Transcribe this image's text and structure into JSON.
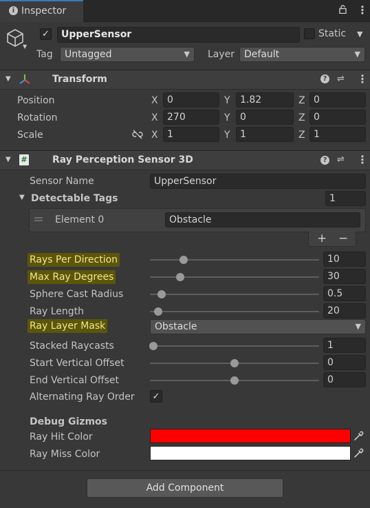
{
  "tab": {
    "title": "Inspector"
  },
  "object": {
    "name": "UpperSensor",
    "static_label": "Static",
    "tag_label": "Tag",
    "tag_value": "Untagged",
    "layer_label": "Layer",
    "layer_value": "Default"
  },
  "transform": {
    "title": "Transform",
    "rows": [
      {
        "label": "Position",
        "x": "0",
        "y": "1.82",
        "z": "0"
      },
      {
        "label": "Rotation",
        "x": "270",
        "y": "0",
        "z": "0"
      },
      {
        "label": "Scale",
        "x": "1",
        "y": "1",
        "z": "1"
      }
    ],
    "axis": {
      "x": "X",
      "y": "Y",
      "z": "Z"
    }
  },
  "ray": {
    "title": "Ray Perception Sensor 3D",
    "sensor_name_label": "Sensor Name",
    "sensor_name_value": "UpperSensor",
    "tags_label": "Detectable Tags",
    "tags_count": "1",
    "element_label": "Element 0",
    "element_value": "Obstacle",
    "plus": "+",
    "minus": "−",
    "sliders": [
      {
        "label": "Rays Per Direction",
        "value": "10",
        "pos": 0.2,
        "highlight": true
      },
      {
        "label": "Max Ray Degrees",
        "value": "30",
        "pos": 0.18,
        "highlight": true
      },
      {
        "label": "Sphere Cast Radius",
        "value": "0.5",
        "pos": 0.07,
        "highlight": false
      },
      {
        "label": "Ray Length",
        "value": "20",
        "pos": 0.05,
        "highlight": false
      }
    ],
    "mask_label": "Ray Layer Mask",
    "mask_value": "Obstacle",
    "sliders2": [
      {
        "label": "Stacked Raycasts",
        "value": "1",
        "pos": 0.02
      },
      {
        "label": "Start Vertical Offset",
        "value": "0",
        "pos": 0.5
      },
      {
        "label": "End Vertical Offset",
        "value": "0",
        "pos": 0.5
      }
    ],
    "alt_label": "Alternating Ray Order",
    "alt_checked": "✓",
    "debug_label": "Debug Gizmos",
    "hit_label": "Ray Hit Color",
    "hit_color": "#ff0000",
    "miss_label": "Ray Miss Color",
    "miss_color": "#ffffff"
  },
  "add_component": "Add Component",
  "icons": {
    "info": "info-icon",
    "lock": "lock-icon",
    "menu": "kebab-menu-icon",
    "cube": "cube-icon",
    "help": "help-icon",
    "preset": "preset-icon",
    "script": "script-icon",
    "link": "constrain-proportions-icon",
    "picker": "eyedropper-icon"
  }
}
